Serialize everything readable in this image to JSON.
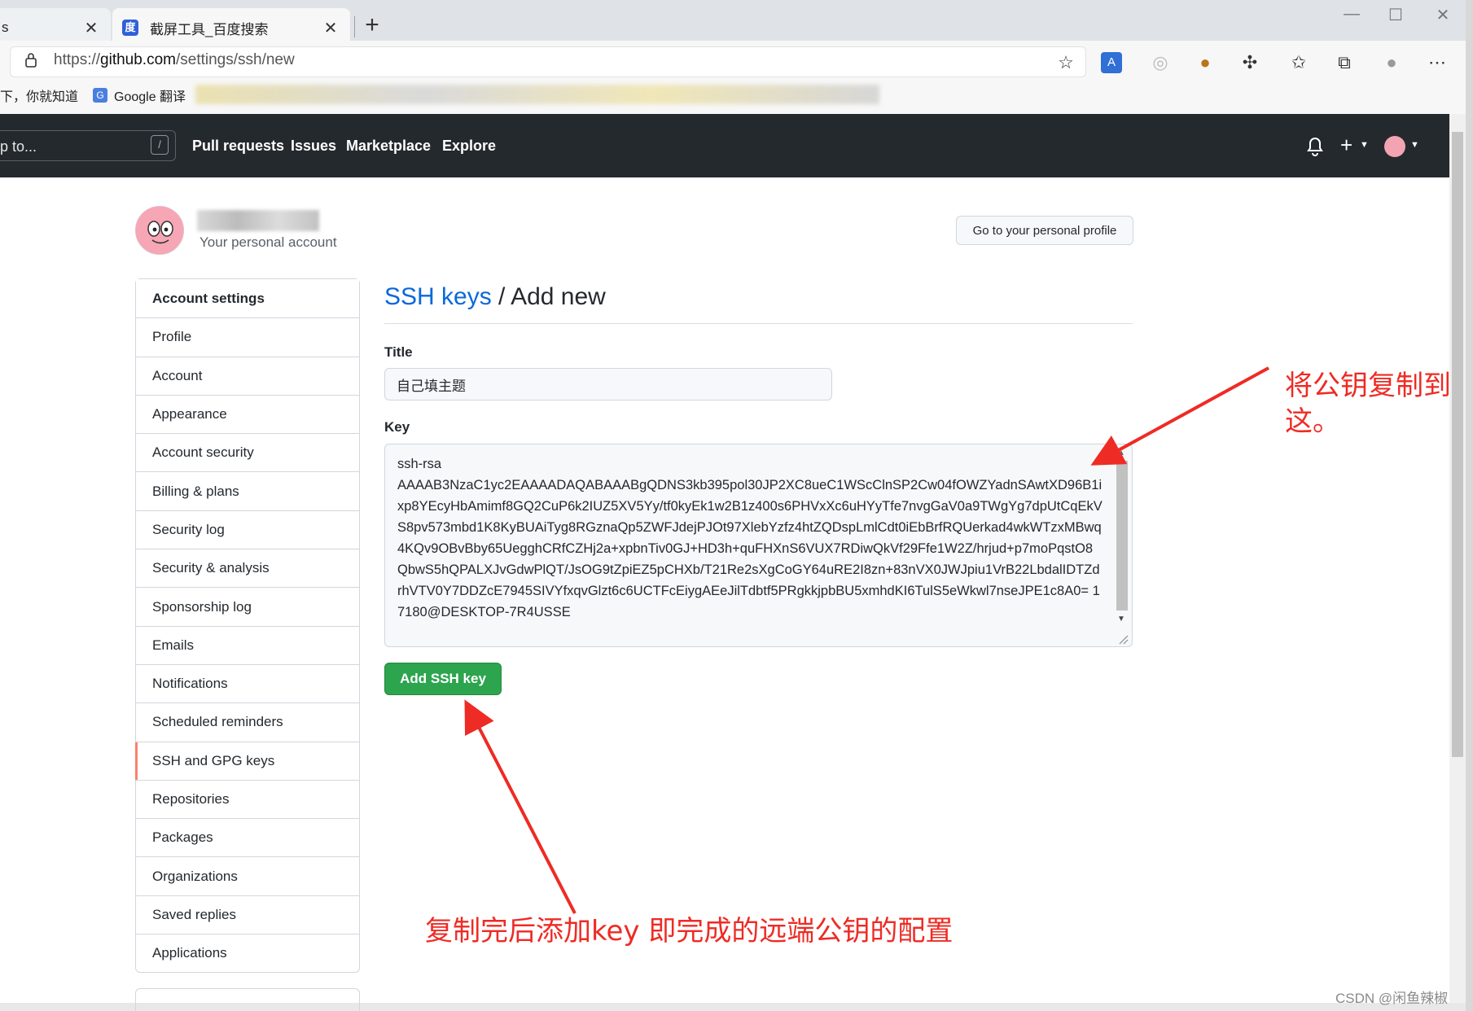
{
  "browser": {
    "prev_tab_label": "s",
    "active_tab_label": "截屏工具_百度搜索",
    "url_scheme": "https://",
    "url_host": "github.com",
    "url_path": "/settings/ssh/new",
    "bookmarks": [
      {
        "label": "下，你就知道"
      },
      {
        "label": "Google 翻译"
      }
    ]
  },
  "header": {
    "search_placeholder": "p to...",
    "slash_hint": "/",
    "nav": [
      "Pull requests",
      "Issues",
      "Marketplace",
      "Explore"
    ]
  },
  "profile": {
    "subtitle": "Your personal account",
    "goto_button": "Go to your personal profile"
  },
  "sidebar": {
    "heading": "Account settings",
    "items": [
      {
        "label": "Profile"
      },
      {
        "label": "Account"
      },
      {
        "label": "Appearance"
      },
      {
        "label": "Account security"
      },
      {
        "label": "Billing & plans"
      },
      {
        "label": "Security log"
      },
      {
        "label": "Security & analysis"
      },
      {
        "label": "Sponsorship log"
      },
      {
        "label": "Emails"
      },
      {
        "label": "Notifications"
      },
      {
        "label": "Scheduled reminders"
      },
      {
        "label": "SSH and GPG keys",
        "selected": true
      },
      {
        "label": "Repositories"
      },
      {
        "label": "Packages"
      },
      {
        "label": "Organizations"
      },
      {
        "label": "Saved replies"
      },
      {
        "label": "Applications"
      }
    ]
  },
  "main": {
    "breadcrumb_link": "SSH keys",
    "breadcrumb_sep": " / ",
    "breadcrumb_current": "Add new",
    "title_label": "Title",
    "title_value": "自己填主题",
    "key_label": "Key",
    "key_value": "ssh-rsa\nAAAAB3NzaC1yc2EAAAADAQABAAABgQDNS3kb395pol30JP2XC8ueC1WScClnSP2Cw04fOWZYadnSAwtXD96B1ixp8YEcyHbAmimf8GQ2CuP6k2IUZ5XV5Yy/tf0kyEk1w2B1z400s6PHVxXc6uHYyTfe7nvgGaV0a9TWgYg7dpUtCqEkVS8pv573mbd1K8KyBUAiTyg8RGznaQp5ZWFJdejPJOt97XlebYzfz4htZQDspLmlCdt0iEbBrfRQUerkad4wkWTzxMBwq4KQv9OBvBby65UegghCRfCZHj2a+xpbnTiv0GJ+HD3h+quFHXnS6VUX7RDiwQkVf29Ffe1W2Z/hrjud+p7moPqstO8QbwS5hQPALXJvGdwPlQT/JsOG9tZpiEZ5pCHXb/T21Re2sXgCoGY64uRE2I8zn+83nVX0JWJpiu1VrB22LbdalIDTZdrhVTV0Y7DDZcE7945SIVYfxqvGlzt6c6UCTFcEiygAEeJilTdbtf5PRgkkjpbBU5xmhdKI6TulS5eWkwl7nseJPE1c8A0= 17180@DESKTOP-7R4USSE",
    "submit_label": "Add SSH key"
  },
  "annotations": {
    "note_right_line1": "将公钥复制到",
    "note_right_line2": "这。",
    "note_bottom": "复制完后添加key 即完成的远端公钥的配置",
    "arrow_color": "#ee2b24"
  },
  "watermark": "CSDN @闲鱼辣椒",
  "colors": {
    "header_bg": "#24292e",
    "primary_button": "#2da44e",
    "link": "#0969da",
    "selected_marker": "#f9826c"
  }
}
